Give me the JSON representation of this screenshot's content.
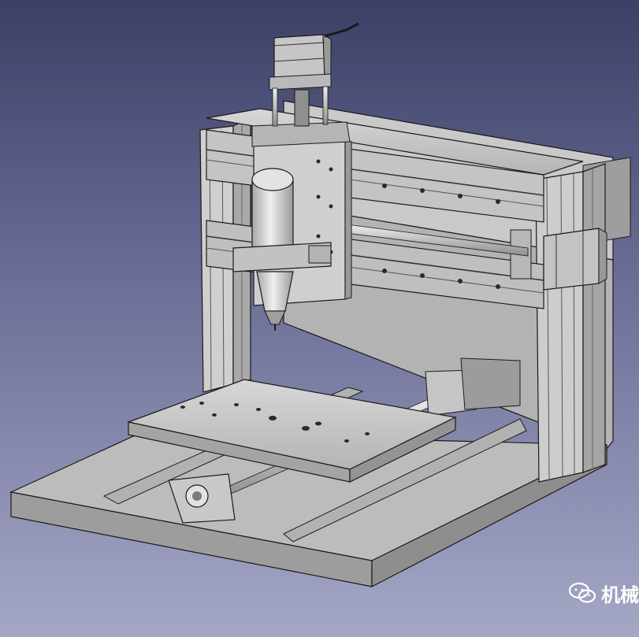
{
  "viewport": {
    "background_top": "#3c3f66",
    "background_bottom": "#a5a7c6"
  },
  "model": {
    "body_color": "#b9b9b9",
    "edge_color": "#1a1a1a"
  },
  "watermark": {
    "icon": "wechat-logo-icon",
    "text": "机械"
  }
}
